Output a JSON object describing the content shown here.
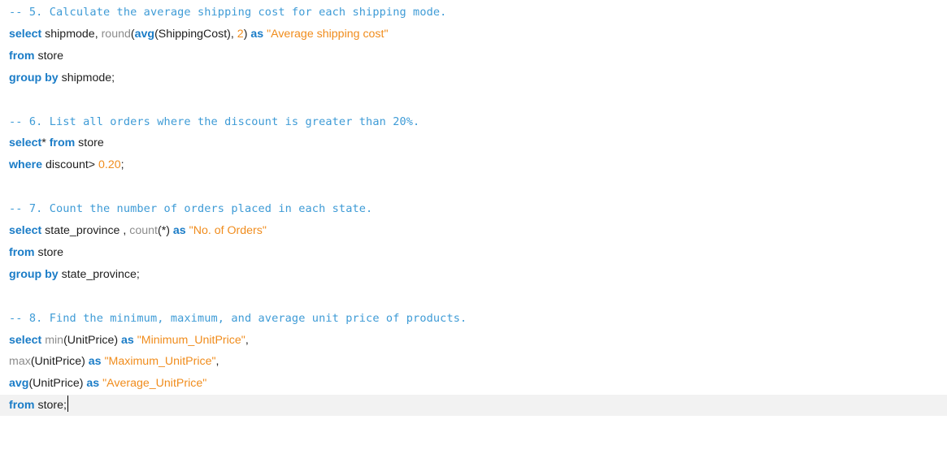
{
  "editor": {
    "lines": [
      {
        "tokens": [
          {
            "type": "comment",
            "text": "-- 5. Calculate the average shipping cost for each shipping mode."
          }
        ]
      },
      {
        "tokens": [
          {
            "type": "kw",
            "text": "select"
          },
          {
            "type": "id",
            "text": " shipmode, "
          },
          {
            "type": "fn",
            "text": "round"
          },
          {
            "type": "id",
            "text": "("
          },
          {
            "type": "kw",
            "text": "avg"
          },
          {
            "type": "id",
            "text": "(ShippingCost), "
          },
          {
            "type": "num",
            "text": "2"
          },
          {
            "type": "id",
            "text": ") "
          },
          {
            "type": "kw",
            "text": "as"
          },
          {
            "type": "id",
            "text": " "
          },
          {
            "type": "str",
            "text": "\"Average shipping cost\""
          }
        ]
      },
      {
        "tokens": [
          {
            "type": "kw",
            "text": "from"
          },
          {
            "type": "id",
            "text": " store"
          }
        ]
      },
      {
        "tokens": [
          {
            "type": "kw",
            "text": "group by"
          },
          {
            "type": "id",
            "text": " shipmode;"
          }
        ]
      },
      {
        "tokens": []
      },
      {
        "tokens": [
          {
            "type": "comment",
            "text": "-- 6. List all orders where the discount is greater than 20%."
          }
        ]
      },
      {
        "tokens": [
          {
            "type": "kw",
            "text": "select"
          },
          {
            "type": "id",
            "text": "* "
          },
          {
            "type": "kw",
            "text": "from"
          },
          {
            "type": "id",
            "text": " store"
          }
        ]
      },
      {
        "tokens": [
          {
            "type": "kw",
            "text": "where"
          },
          {
            "type": "id",
            "text": " discount> "
          },
          {
            "type": "num",
            "text": "0.20"
          },
          {
            "type": "id",
            "text": ";"
          }
        ]
      },
      {
        "tokens": []
      },
      {
        "tokens": [
          {
            "type": "comment",
            "text": "-- 7. Count the number of orders placed in each state."
          }
        ]
      },
      {
        "tokens": [
          {
            "type": "kw",
            "text": "select"
          },
          {
            "type": "id",
            "text": " state_province , "
          },
          {
            "type": "fn",
            "text": "count"
          },
          {
            "type": "id",
            "text": "(*) "
          },
          {
            "type": "kw",
            "text": "as"
          },
          {
            "type": "id",
            "text": " "
          },
          {
            "type": "str",
            "text": "\"No. of Orders\""
          }
        ]
      },
      {
        "tokens": [
          {
            "type": "kw",
            "text": "from"
          },
          {
            "type": "id",
            "text": " store"
          }
        ]
      },
      {
        "tokens": [
          {
            "type": "kw",
            "text": "group by"
          },
          {
            "type": "id",
            "text": " state_province;"
          }
        ]
      },
      {
        "tokens": []
      },
      {
        "tokens": [
          {
            "type": "comment",
            "text": "-- 8. Find the minimum, maximum, and average unit price of products."
          }
        ]
      },
      {
        "tokens": [
          {
            "type": "kw",
            "text": "select"
          },
          {
            "type": "id",
            "text": " "
          },
          {
            "type": "fn",
            "text": "min"
          },
          {
            "type": "id",
            "text": "(UnitPrice) "
          },
          {
            "type": "kw",
            "text": "as"
          },
          {
            "type": "id",
            "text": " "
          },
          {
            "type": "str",
            "text": "\"Minimum_UnitPrice\""
          },
          {
            "type": "id",
            "text": ","
          }
        ]
      },
      {
        "tokens": [
          {
            "type": "fn",
            "text": "max"
          },
          {
            "type": "id",
            "text": "(UnitPrice) "
          },
          {
            "type": "kw",
            "text": "as"
          },
          {
            "type": "id",
            "text": " "
          },
          {
            "type": "str",
            "text": "\"Maximum_UnitPrice\""
          },
          {
            "type": "id",
            "text": ","
          }
        ]
      },
      {
        "tokens": [
          {
            "type": "kw",
            "text": "avg"
          },
          {
            "type": "id",
            "text": "(UnitPrice) "
          },
          {
            "type": "kw",
            "text": "as"
          },
          {
            "type": "id",
            "text": " "
          },
          {
            "type": "str",
            "text": "\"Average_UnitPrice\""
          }
        ]
      },
      {
        "tokens": [
          {
            "type": "kw",
            "text": "from"
          },
          {
            "type": "id",
            "text": " store;"
          }
        ],
        "current": true,
        "caret": true
      }
    ],
    "colors": {
      "comment": "#3e9bd6",
      "keyword": "#1a7cc7",
      "identifier": "#1e1e1e",
      "function": "#8c8c8c",
      "string": "#f08c1c",
      "number": "#f08c1c",
      "current_line": "#f2f2f2"
    }
  }
}
